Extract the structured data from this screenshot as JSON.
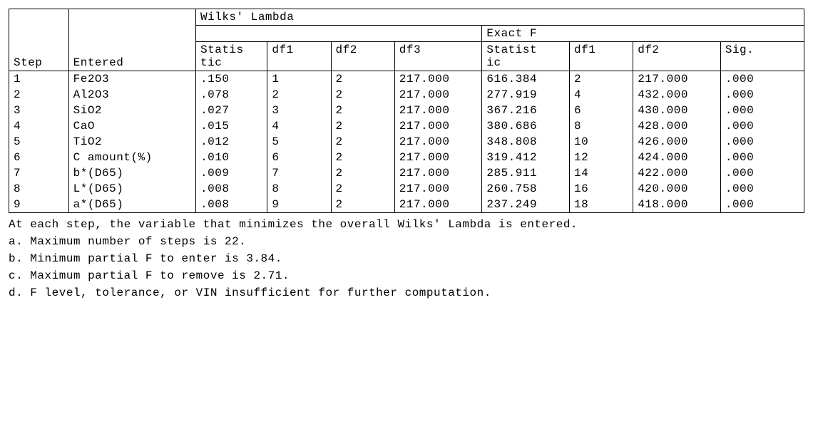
{
  "headers": {
    "step": "Step",
    "entered": "Entered",
    "wilks": "Wilks' Lambda",
    "exact_f": "Exact F",
    "statistic_wrap": "Statistic",
    "statistic_wrap2": "Statistic",
    "df1": "df1",
    "df2": "df2",
    "df3": "df3",
    "sig": "Sig."
  },
  "rows": [
    {
      "step": "1",
      "entered": "Fe2O3",
      "stat": ".150",
      "d1": "1",
      "d2": "2",
      "d3": "217.000",
      "fstat": "616.384",
      "fd1": "2",
      "fd2": "217.000",
      "sig": ".000"
    },
    {
      "step": "2",
      "entered": "Al2O3",
      "stat": ".078",
      "d1": "2",
      "d2": "2",
      "d3": "217.000",
      "fstat": "277.919",
      "fd1": "4",
      "fd2": "432.000",
      "sig": ".000"
    },
    {
      "step": "3",
      "entered": "SiO2",
      "stat": ".027",
      "d1": "3",
      "d2": "2",
      "d3": "217.000",
      "fstat": "367.216",
      "fd1": "6",
      "fd2": "430.000",
      "sig": ".000"
    },
    {
      "step": "4",
      "entered": "CaO",
      "stat": ".015",
      "d1": "4",
      "d2": "2",
      "d3": "217.000",
      "fstat": "380.686",
      "fd1": "8",
      "fd2": "428.000",
      "sig": ".000"
    },
    {
      "step": "5",
      "entered": "TiO2",
      "stat": ".012",
      "d1": "5",
      "d2": "2",
      "d3": "217.000",
      "fstat": "348.808",
      "fd1": "10",
      "fd2": "426.000",
      "sig": ".000"
    },
    {
      "step": "6",
      "entered": "C amount(%)",
      "stat": ".010",
      "d1": "6",
      "d2": "2",
      "d3": "217.000",
      "fstat": "319.412",
      "fd1": "12",
      "fd2": "424.000",
      "sig": ".000"
    },
    {
      "step": "7",
      "entered": "b*(D65)",
      "stat": ".009",
      "d1": "7",
      "d2": "2",
      "d3": "217.000",
      "fstat": "285.911",
      "fd1": "14",
      "fd2": "422.000",
      "sig": ".000"
    },
    {
      "step": "8",
      "entered": "L*(D65)",
      "stat": ".008",
      "d1": "8",
      "d2": "2",
      "d3": "217.000",
      "fstat": "260.758",
      "fd1": "16",
      "fd2": "420.000",
      "sig": ".000"
    },
    {
      "step": "9",
      "entered": "a*(D65)",
      "stat": ".008",
      "d1": "9",
      "d2": "2",
      "d3": "217.000",
      "fstat": "237.249",
      "fd1": "18",
      "fd2": "418.000",
      "sig": ".000"
    }
  ],
  "notes": {
    "intro": "At each step, the variable that minimizes the overall Wilks' Lambda is entered.",
    "a": "a. Maximum number of steps is 22.",
    "b": "b. Minimum partial F to enter is 3.84.",
    "c": "c. Maximum partial F to remove is 2.71.",
    "d": "d. F level, tolerance, or VIN insufficient for further computation."
  }
}
